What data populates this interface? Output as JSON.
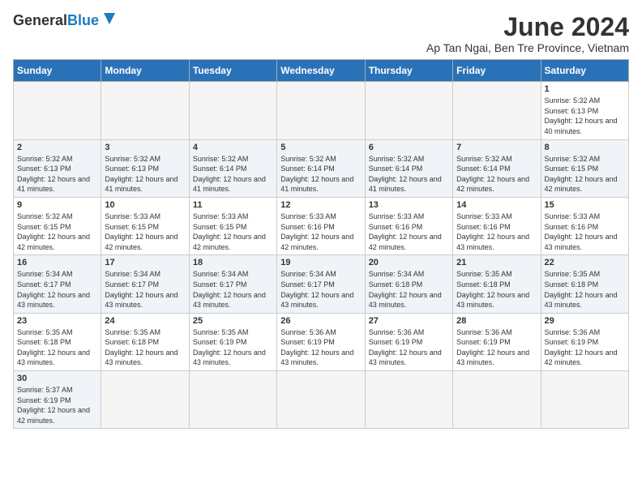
{
  "header": {
    "logo_general": "General",
    "logo_blue": "Blue",
    "month_title": "June 2024",
    "subtitle": "Ap Tan Ngai, Ben Tre Province, Vietnam"
  },
  "weekdays": [
    "Sunday",
    "Monday",
    "Tuesday",
    "Wednesday",
    "Thursday",
    "Friday",
    "Saturday"
  ],
  "weeks": [
    [
      {
        "day": "",
        "info": ""
      },
      {
        "day": "",
        "info": ""
      },
      {
        "day": "",
        "info": ""
      },
      {
        "day": "",
        "info": ""
      },
      {
        "day": "",
        "info": ""
      },
      {
        "day": "",
        "info": ""
      },
      {
        "day": "1",
        "info": "Sunrise: 5:32 AM\nSunset: 6:13 PM\nDaylight: 12 hours and 40 minutes."
      }
    ],
    [
      {
        "day": "2",
        "info": "Sunrise: 5:32 AM\nSunset: 6:13 PM\nDaylight: 12 hours and 41 minutes."
      },
      {
        "day": "3",
        "info": "Sunrise: 5:32 AM\nSunset: 6:13 PM\nDaylight: 12 hours and 41 minutes."
      },
      {
        "day": "4",
        "info": "Sunrise: 5:32 AM\nSunset: 6:14 PM\nDaylight: 12 hours and 41 minutes."
      },
      {
        "day": "5",
        "info": "Sunrise: 5:32 AM\nSunset: 6:14 PM\nDaylight: 12 hours and 41 minutes."
      },
      {
        "day": "6",
        "info": "Sunrise: 5:32 AM\nSunset: 6:14 PM\nDaylight: 12 hours and 41 minutes."
      },
      {
        "day": "7",
        "info": "Sunrise: 5:32 AM\nSunset: 6:14 PM\nDaylight: 12 hours and 42 minutes."
      },
      {
        "day": "8",
        "info": "Sunrise: 5:32 AM\nSunset: 6:15 PM\nDaylight: 12 hours and 42 minutes."
      }
    ],
    [
      {
        "day": "9",
        "info": "Sunrise: 5:32 AM\nSunset: 6:15 PM\nDaylight: 12 hours and 42 minutes."
      },
      {
        "day": "10",
        "info": "Sunrise: 5:33 AM\nSunset: 6:15 PM\nDaylight: 12 hours and 42 minutes."
      },
      {
        "day": "11",
        "info": "Sunrise: 5:33 AM\nSunset: 6:15 PM\nDaylight: 12 hours and 42 minutes."
      },
      {
        "day": "12",
        "info": "Sunrise: 5:33 AM\nSunset: 6:16 PM\nDaylight: 12 hours and 42 minutes."
      },
      {
        "day": "13",
        "info": "Sunrise: 5:33 AM\nSunset: 6:16 PM\nDaylight: 12 hours and 42 minutes."
      },
      {
        "day": "14",
        "info": "Sunrise: 5:33 AM\nSunset: 6:16 PM\nDaylight: 12 hours and 43 minutes."
      },
      {
        "day": "15",
        "info": "Sunrise: 5:33 AM\nSunset: 6:16 PM\nDaylight: 12 hours and 43 minutes."
      }
    ],
    [
      {
        "day": "16",
        "info": "Sunrise: 5:34 AM\nSunset: 6:17 PM\nDaylight: 12 hours and 43 minutes."
      },
      {
        "day": "17",
        "info": "Sunrise: 5:34 AM\nSunset: 6:17 PM\nDaylight: 12 hours and 43 minutes."
      },
      {
        "day": "18",
        "info": "Sunrise: 5:34 AM\nSunset: 6:17 PM\nDaylight: 12 hours and 43 minutes."
      },
      {
        "day": "19",
        "info": "Sunrise: 5:34 AM\nSunset: 6:17 PM\nDaylight: 12 hours and 43 minutes."
      },
      {
        "day": "20",
        "info": "Sunrise: 5:34 AM\nSunset: 6:18 PM\nDaylight: 12 hours and 43 minutes."
      },
      {
        "day": "21",
        "info": "Sunrise: 5:35 AM\nSunset: 6:18 PM\nDaylight: 12 hours and 43 minutes."
      },
      {
        "day": "22",
        "info": "Sunrise: 5:35 AM\nSunset: 6:18 PM\nDaylight: 12 hours and 43 minutes."
      }
    ],
    [
      {
        "day": "23",
        "info": "Sunrise: 5:35 AM\nSunset: 6:18 PM\nDaylight: 12 hours and 43 minutes."
      },
      {
        "day": "24",
        "info": "Sunrise: 5:35 AM\nSunset: 6:18 PM\nDaylight: 12 hours and 43 minutes."
      },
      {
        "day": "25",
        "info": "Sunrise: 5:35 AM\nSunset: 6:19 PM\nDaylight: 12 hours and 43 minutes."
      },
      {
        "day": "26",
        "info": "Sunrise: 5:36 AM\nSunset: 6:19 PM\nDaylight: 12 hours and 43 minutes."
      },
      {
        "day": "27",
        "info": "Sunrise: 5:36 AM\nSunset: 6:19 PM\nDaylight: 12 hours and 43 minutes."
      },
      {
        "day": "28",
        "info": "Sunrise: 5:36 AM\nSunset: 6:19 PM\nDaylight: 12 hours and 43 minutes."
      },
      {
        "day": "29",
        "info": "Sunrise: 5:36 AM\nSunset: 6:19 PM\nDaylight: 12 hours and 42 minutes."
      }
    ],
    [
      {
        "day": "30",
        "info": "Sunrise: 5:37 AM\nSunset: 6:19 PM\nDaylight: 12 hours and 42 minutes."
      },
      {
        "day": "",
        "info": ""
      },
      {
        "day": "",
        "info": ""
      },
      {
        "day": "",
        "info": ""
      },
      {
        "day": "",
        "info": ""
      },
      {
        "day": "",
        "info": ""
      },
      {
        "day": "",
        "info": ""
      }
    ]
  ]
}
